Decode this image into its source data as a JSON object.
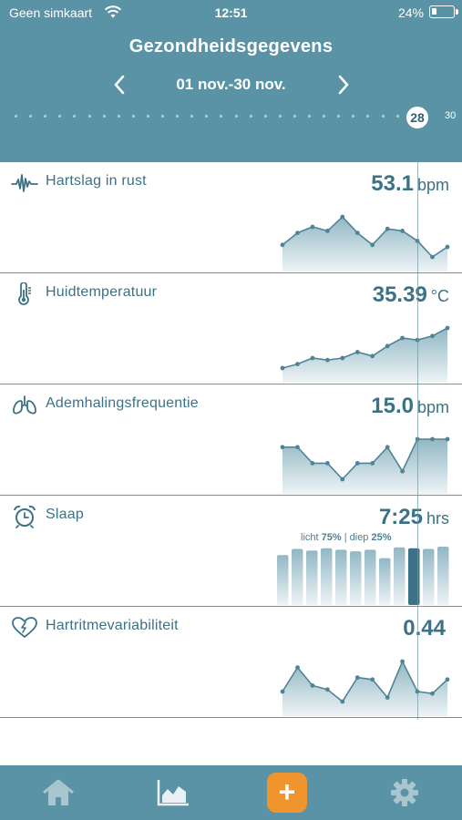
{
  "status_bar": {
    "carrier": "Geen simkaart",
    "time": "12:51",
    "battery": "24%",
    "battery_level": 0.24
  },
  "header": {
    "title": "Gezondheidsgegevens",
    "date_range": "01 nov.-30 nov.",
    "selected_day": "28",
    "last_day": "30"
  },
  "cards": [
    {
      "id": "rest-hr",
      "title": "Hartslag in rust",
      "value": "53.1",
      "unit": "bpm",
      "icon": "heartbeat-wave-icon",
      "chart": {
        "type": "area",
        "values": [
          53.0,
          53.6,
          53.9,
          53.7,
          54.4,
          53.6,
          53.0,
          53.8,
          53.7,
          53.2,
          52.4,
          52.9
        ]
      }
    },
    {
      "id": "skin-temp",
      "title": "Huidtemperatuur",
      "value": "35.39",
      "unit": "°C",
      "icon": "thermometer-icon",
      "chart": {
        "type": "area",
        "values": [
          34.0,
          34.2,
          34.5,
          34.4,
          34.5,
          34.8,
          34.6,
          35.1,
          35.5,
          35.4,
          35.6,
          36.0
        ]
      }
    },
    {
      "id": "resp-rate",
      "title": "Ademhalingsfrequentie",
      "value": "15.0",
      "unit": "bpm",
      "icon": "lungs-icon",
      "chart": {
        "type": "area",
        "values": [
          14.9,
          14.9,
          14.7,
          14.7,
          14.5,
          14.7,
          14.7,
          14.9,
          14.6,
          15.0,
          15.0,
          15.0
        ]
      }
    },
    {
      "id": "sleep",
      "title": "Slaap",
      "value": "7:25",
      "unit": "hrs",
      "icon": "alarm-clock-icon",
      "sub": {
        "prefix": "licht",
        "light": "75%",
        "sep": "| diep",
        "deep": "25%"
      },
      "chart": {
        "type": "bar",
        "values": [
          6.5,
          7.3,
          7.1,
          7.4,
          7.2,
          7.0,
          7.2,
          6.1,
          7.5,
          7.4,
          7.3,
          7.6
        ],
        "highlight_index": 9
      }
    },
    {
      "id": "hrv",
      "title": "Hartritmevariabiliteit",
      "value": "0.44",
      "unit": "",
      "icon": "heart-bolt-icon",
      "chart": {
        "type": "area",
        "values": [
          0.3,
          0.42,
          0.33,
          0.31,
          0.25,
          0.37,
          0.36,
          0.27,
          0.45,
          0.3,
          0.29,
          0.36
        ]
      }
    }
  ],
  "tabs": [
    {
      "name": "tab-home",
      "icon": "home-icon"
    },
    {
      "name": "tab-charts",
      "icon": "area-chart-icon"
    },
    {
      "name": "tab-add",
      "icon": "plus-icon",
      "label": "+"
    },
    {
      "name": "tab-settings",
      "icon": "gear-icon"
    }
  ],
  "colors": {
    "primary": "#5a93a6",
    "text": "#3d7186",
    "accent": "#f0952e"
  }
}
